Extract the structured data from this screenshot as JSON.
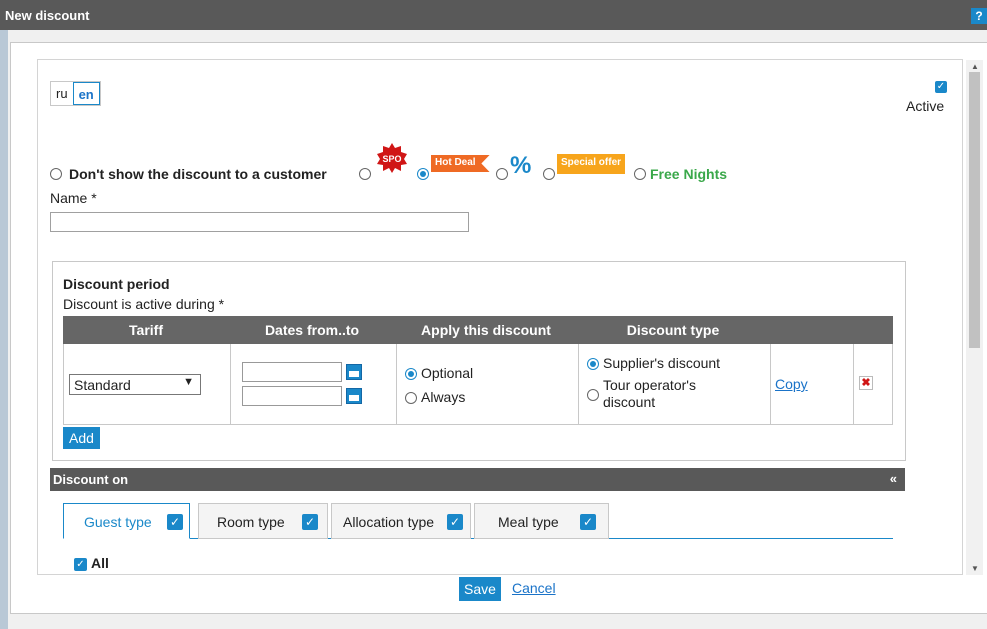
{
  "window": {
    "title": "New discount",
    "help": "?"
  },
  "languages": [
    "ru",
    "en"
  ],
  "active": {
    "label": "Active",
    "checked": true
  },
  "display_options": {
    "no_show_label": "Don't show the discount to a customer",
    "spo_badge": "SPO",
    "hot_deal_badge": "Hot Deal",
    "percent_badge": "%",
    "special_offer_badge": "Special offer",
    "free_nights_label": "Free Nights",
    "selected": "hot_deal"
  },
  "name": {
    "label": "Name *",
    "value": ""
  },
  "period": {
    "title": "Discount period",
    "subtitle": "Discount is active during *",
    "columns": [
      "Tariff",
      "Dates from..to",
      "Apply this discount",
      "Discount type"
    ],
    "row": {
      "tariff": "Standard",
      "apply_options": [
        "Optional",
        "Always"
      ],
      "apply_selected": "Optional",
      "type_options": [
        "Supplier's discount",
        "Tour operator's",
        "discount"
      ],
      "type_selected": "Supplier's discount",
      "copy_label": "Copy",
      "delete_icon": "✖"
    },
    "add_label": "Add"
  },
  "discount_on": {
    "title": "Discount on",
    "collapse_icon": "«",
    "tabs": [
      {
        "label": "Guest type",
        "checked": true
      },
      {
        "label": "Room type",
        "checked": true
      },
      {
        "label": "Allocation type",
        "checked": true
      },
      {
        "label": "Meal type",
        "checked": true
      }
    ],
    "all_label": "All"
  },
  "footer": {
    "save_label": "Save",
    "cancel_label": "Cancel"
  },
  "colors": {
    "accent": "#1a88c9",
    "title_bar": "#595959",
    "hot_deal": "#ef6a24",
    "special_offer": "#f7a51c",
    "free_nights": "#3aa84a",
    "spo": "#d01616"
  }
}
